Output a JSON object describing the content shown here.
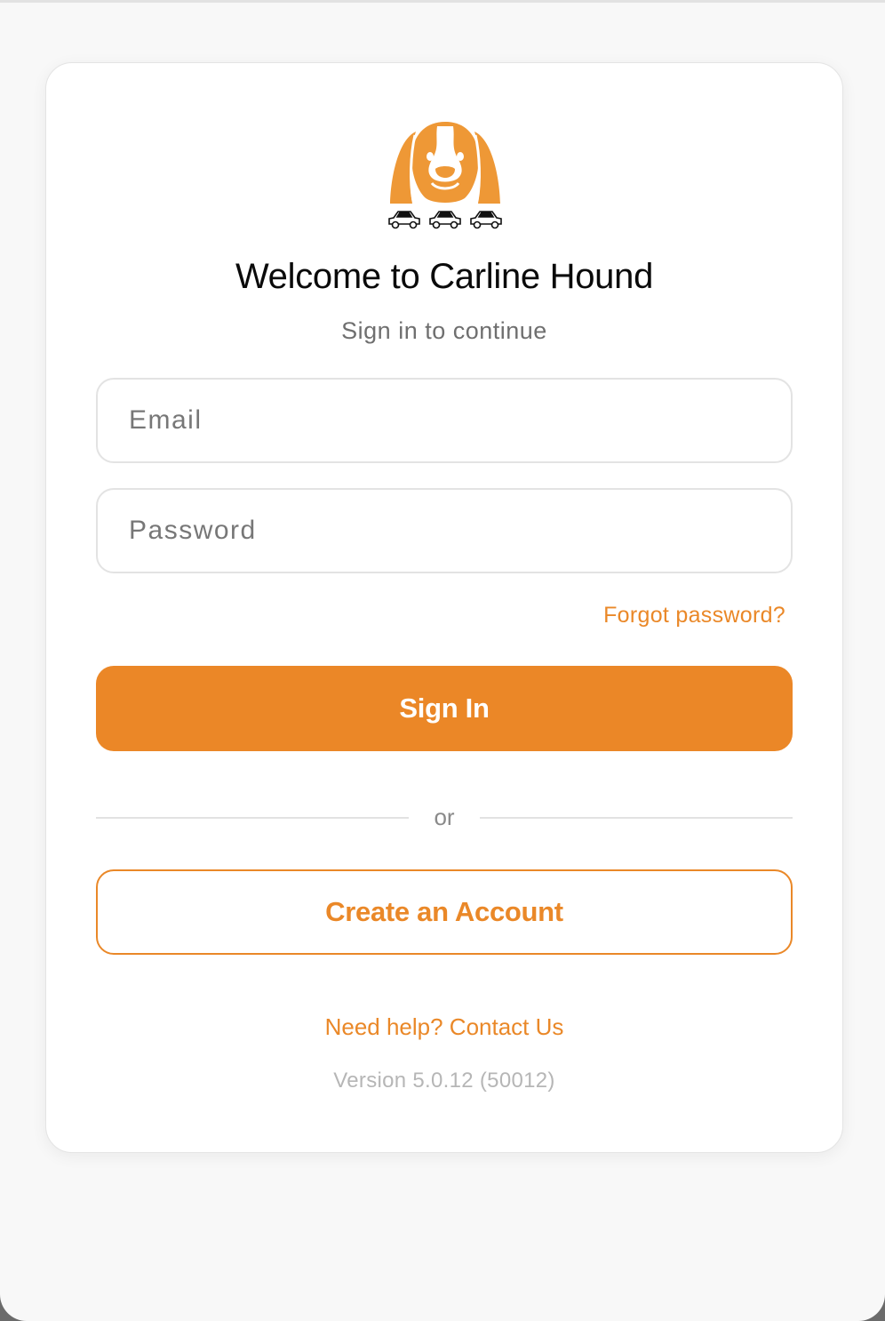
{
  "app": {
    "title": "Welcome to Carline Hound",
    "subtitle": "Sign in to continue",
    "logo_icon": "carline-hound-dog-with-cars-logo"
  },
  "form": {
    "email_placeholder": "Email",
    "email_value": "",
    "password_placeholder": "Password",
    "password_value": "",
    "forgot_label": "Forgot password?",
    "signin_label": "Sign In",
    "divider_label": "or",
    "create_account_label": "Create an Account"
  },
  "footer": {
    "help_label": "Need help? Contact Us",
    "version": "Version 5.0.12 (50012)"
  },
  "colors": {
    "accent": "#eb8727",
    "background": "#f8f8f8",
    "card": "#ffffff",
    "muted_text": "#6f6f6f"
  }
}
